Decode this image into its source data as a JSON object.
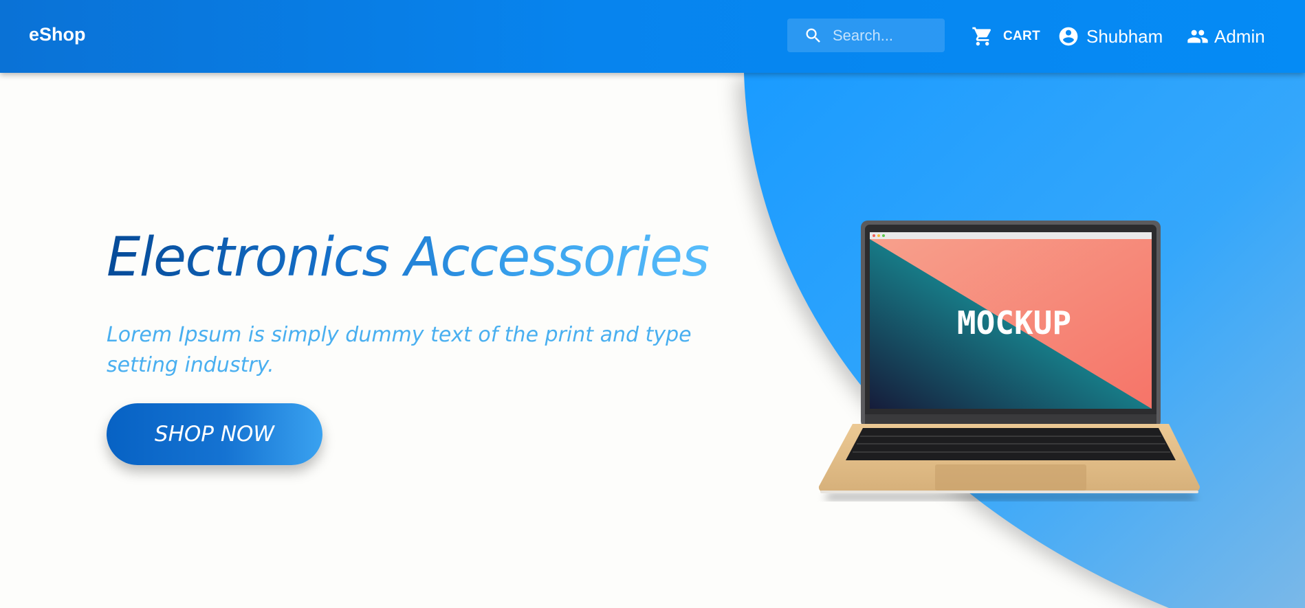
{
  "navbar": {
    "brand": "eShop",
    "search_placeholder": "Search...",
    "cart_label": "CART",
    "user_label": "Shubham",
    "admin_label": "Admin",
    "icons": [
      "search-icon",
      "cart-icon",
      "account-circle-icon",
      "group-icon"
    ]
  },
  "hero": {
    "title": "Electronics Accessories",
    "subtitle": "Lorem Ipsum is simply dummy text of the print and type setting industry.",
    "button_label": "SHOP NOW",
    "mockup_text": "MOCKUP"
  },
  "colors": {
    "primary": "#0784ee",
    "accent_light": "#49aff0",
    "background": "#fdfdfb"
  }
}
